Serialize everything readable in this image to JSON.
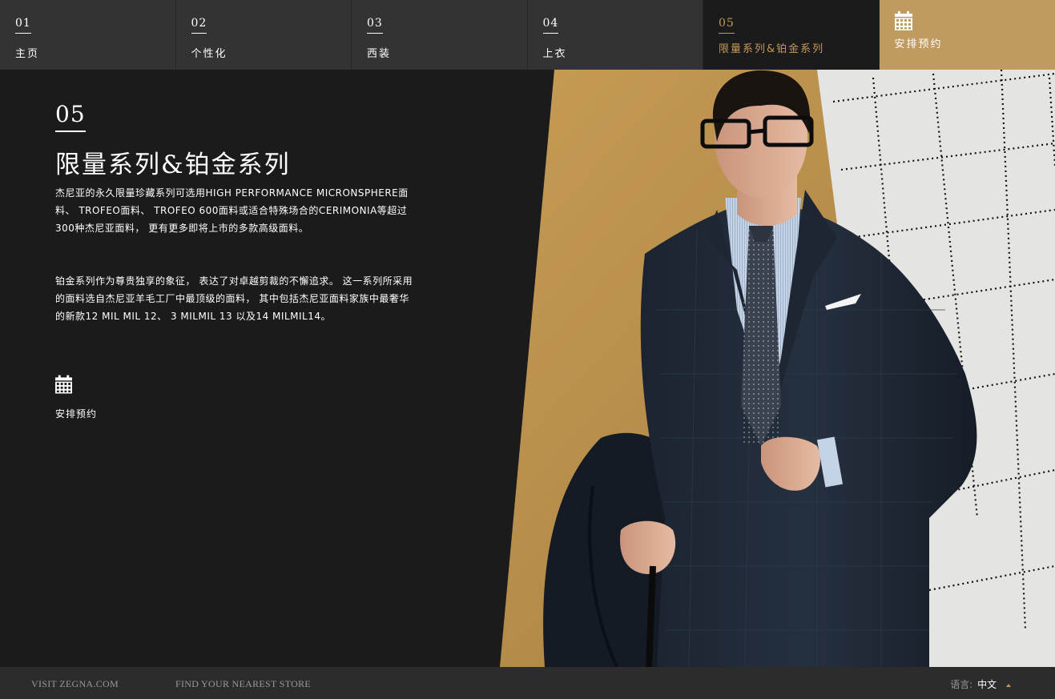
{
  "nav": [
    {
      "num": "01",
      "label": "主页"
    },
    {
      "num": "02",
      "label": "个性化"
    },
    {
      "num": "03",
      "label": "西装"
    },
    {
      "num": "04",
      "label": "上衣"
    },
    {
      "num": "05",
      "label": "限量系列&铂金系列"
    }
  ],
  "nav_cta": {
    "label": "安排预约",
    "icon": "calendar-icon"
  },
  "section": {
    "num": "05",
    "title": "限量系列&铂金系列",
    "para1": "杰尼亚的永久限量珍藏系列可选用HIGH PERFORMANCE MICRONSPHERE面料、 TROFEO面料、 TROFEO 600面料或适合特殊场合的CERIMONIA等超过300种杰尼亚面料， 更有更多即将上市的多款高级面料。",
    "para2": "铂金系列作为尊贵独享的象征， 表达了对卓越剪裁的不懈追求。 这一系列所采用的面料选自杰尼亚羊毛工厂中最顶级的面料， 其中包括杰尼亚面料家族中最奢华的新款12 MIL MIL 12、 3 MILMIL 13 以及14 MILMIL14。",
    "cta_label": "安排预约"
  },
  "footer": {
    "visit": "VISIT ZEGNA.COM",
    "store": "FIND YOUR NEAREST STORE",
    "lang_label": "语言:",
    "lang_value": "中文"
  },
  "colors": {
    "accent": "#c09a5e",
    "bg": "#1b1b1b",
    "nav_bg": "#333333",
    "footer_bg": "#2c2c2c"
  }
}
